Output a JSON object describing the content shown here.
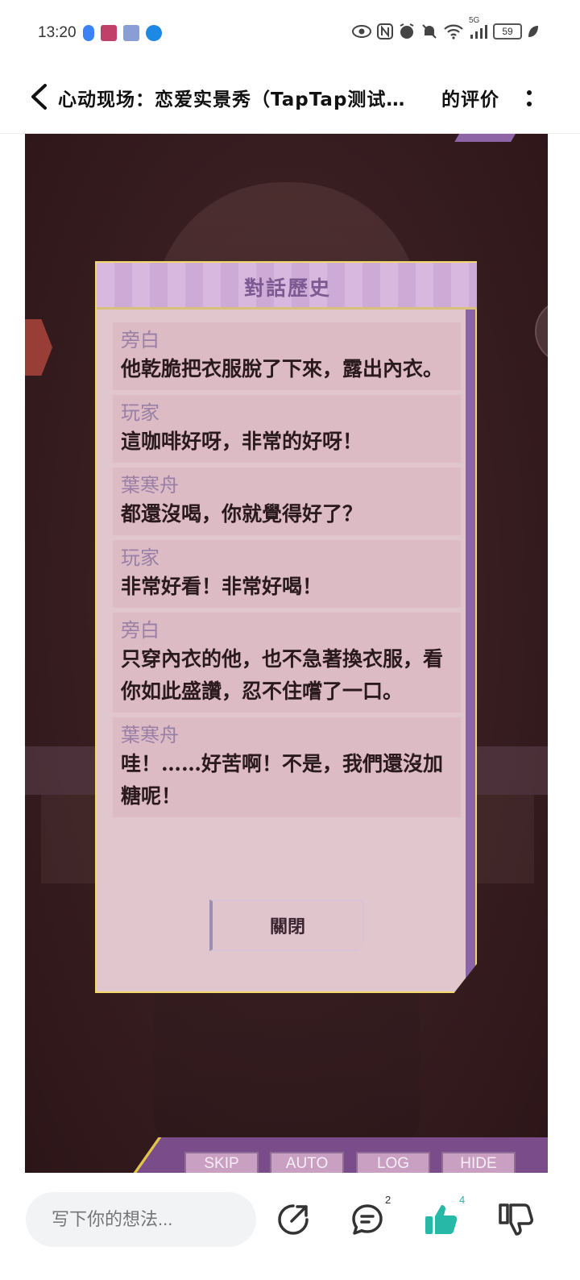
{
  "status_bar": {
    "time": "13:20",
    "battery": "59",
    "signal_label": "5G"
  },
  "header": {
    "title": "心动现场：恋爱实景秀（TapTap测试…",
    "suffix": "的评价"
  },
  "dialog": {
    "title": "對話歷史",
    "entries": [
      {
        "speaker": "旁白",
        "text": "他乾脆把衣服脫了下來，露出內衣。"
      },
      {
        "speaker": "玩家",
        "text": "這咖啡好呀，非常的好呀！"
      },
      {
        "speaker": "葉寒舟",
        "text": "都還沒喝，你就覺得好了？"
      },
      {
        "speaker": "玩家",
        "text": "非常好看！非常好喝！"
      },
      {
        "speaker": "旁白",
        "text": "只穿內衣的他，也不急著換衣服，看你如此盛讚，忍不住嚐了一口。"
      },
      {
        "speaker": "葉寒舟",
        "text": "哇！……好苦啊！不是，我們還沒加糖呢！"
      }
    ],
    "close_label": "關閉"
  },
  "game_controls": {
    "skip": "SKIP",
    "auto": "AUTO",
    "log": "LOG",
    "hide": "HIDE"
  },
  "bottom_bar": {
    "comment_placeholder": "写下你的想法...",
    "comment_count": "2",
    "like_count": "4"
  },
  "colors": {
    "accent_like": "#27b8a8",
    "dialog_title": "#7d5b92",
    "speaker": "#9a7fa6"
  }
}
